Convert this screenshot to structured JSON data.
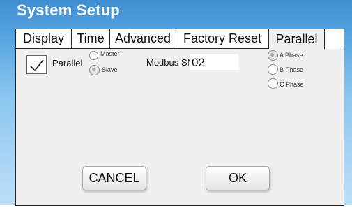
{
  "window": {
    "title": "System Setup"
  },
  "tabs": [
    {
      "label": "Display",
      "active": false
    },
    {
      "label": "Time",
      "active": false
    },
    {
      "label": "Advanced",
      "active": false
    },
    {
      "label": "Factory Reset",
      "active": false
    },
    {
      "label": "Parallel",
      "active": true
    }
  ],
  "parallel": {
    "enabled_label": "Parallel",
    "enabled": true,
    "checkmark_icon": "checkmark-icon",
    "mode_options": [
      {
        "label": "Master",
        "selected": false
      },
      {
        "label": "Slave",
        "selected": true
      }
    ],
    "modbus_label": "Modbus SN",
    "modbus_value": "02",
    "phase_options": [
      {
        "label": "A Phase",
        "selected": true
      },
      {
        "label": "B Phase",
        "selected": false
      },
      {
        "label": "C Phase",
        "selected": false
      }
    ]
  },
  "buttons": {
    "cancel_label": "CANCEL",
    "ok_label": "OK"
  },
  "colors": {
    "header_gradient_top": "#3f8fd2",
    "header_gradient_bottom": "#bfe0f8",
    "panel_background": "#f0f0f0"
  }
}
